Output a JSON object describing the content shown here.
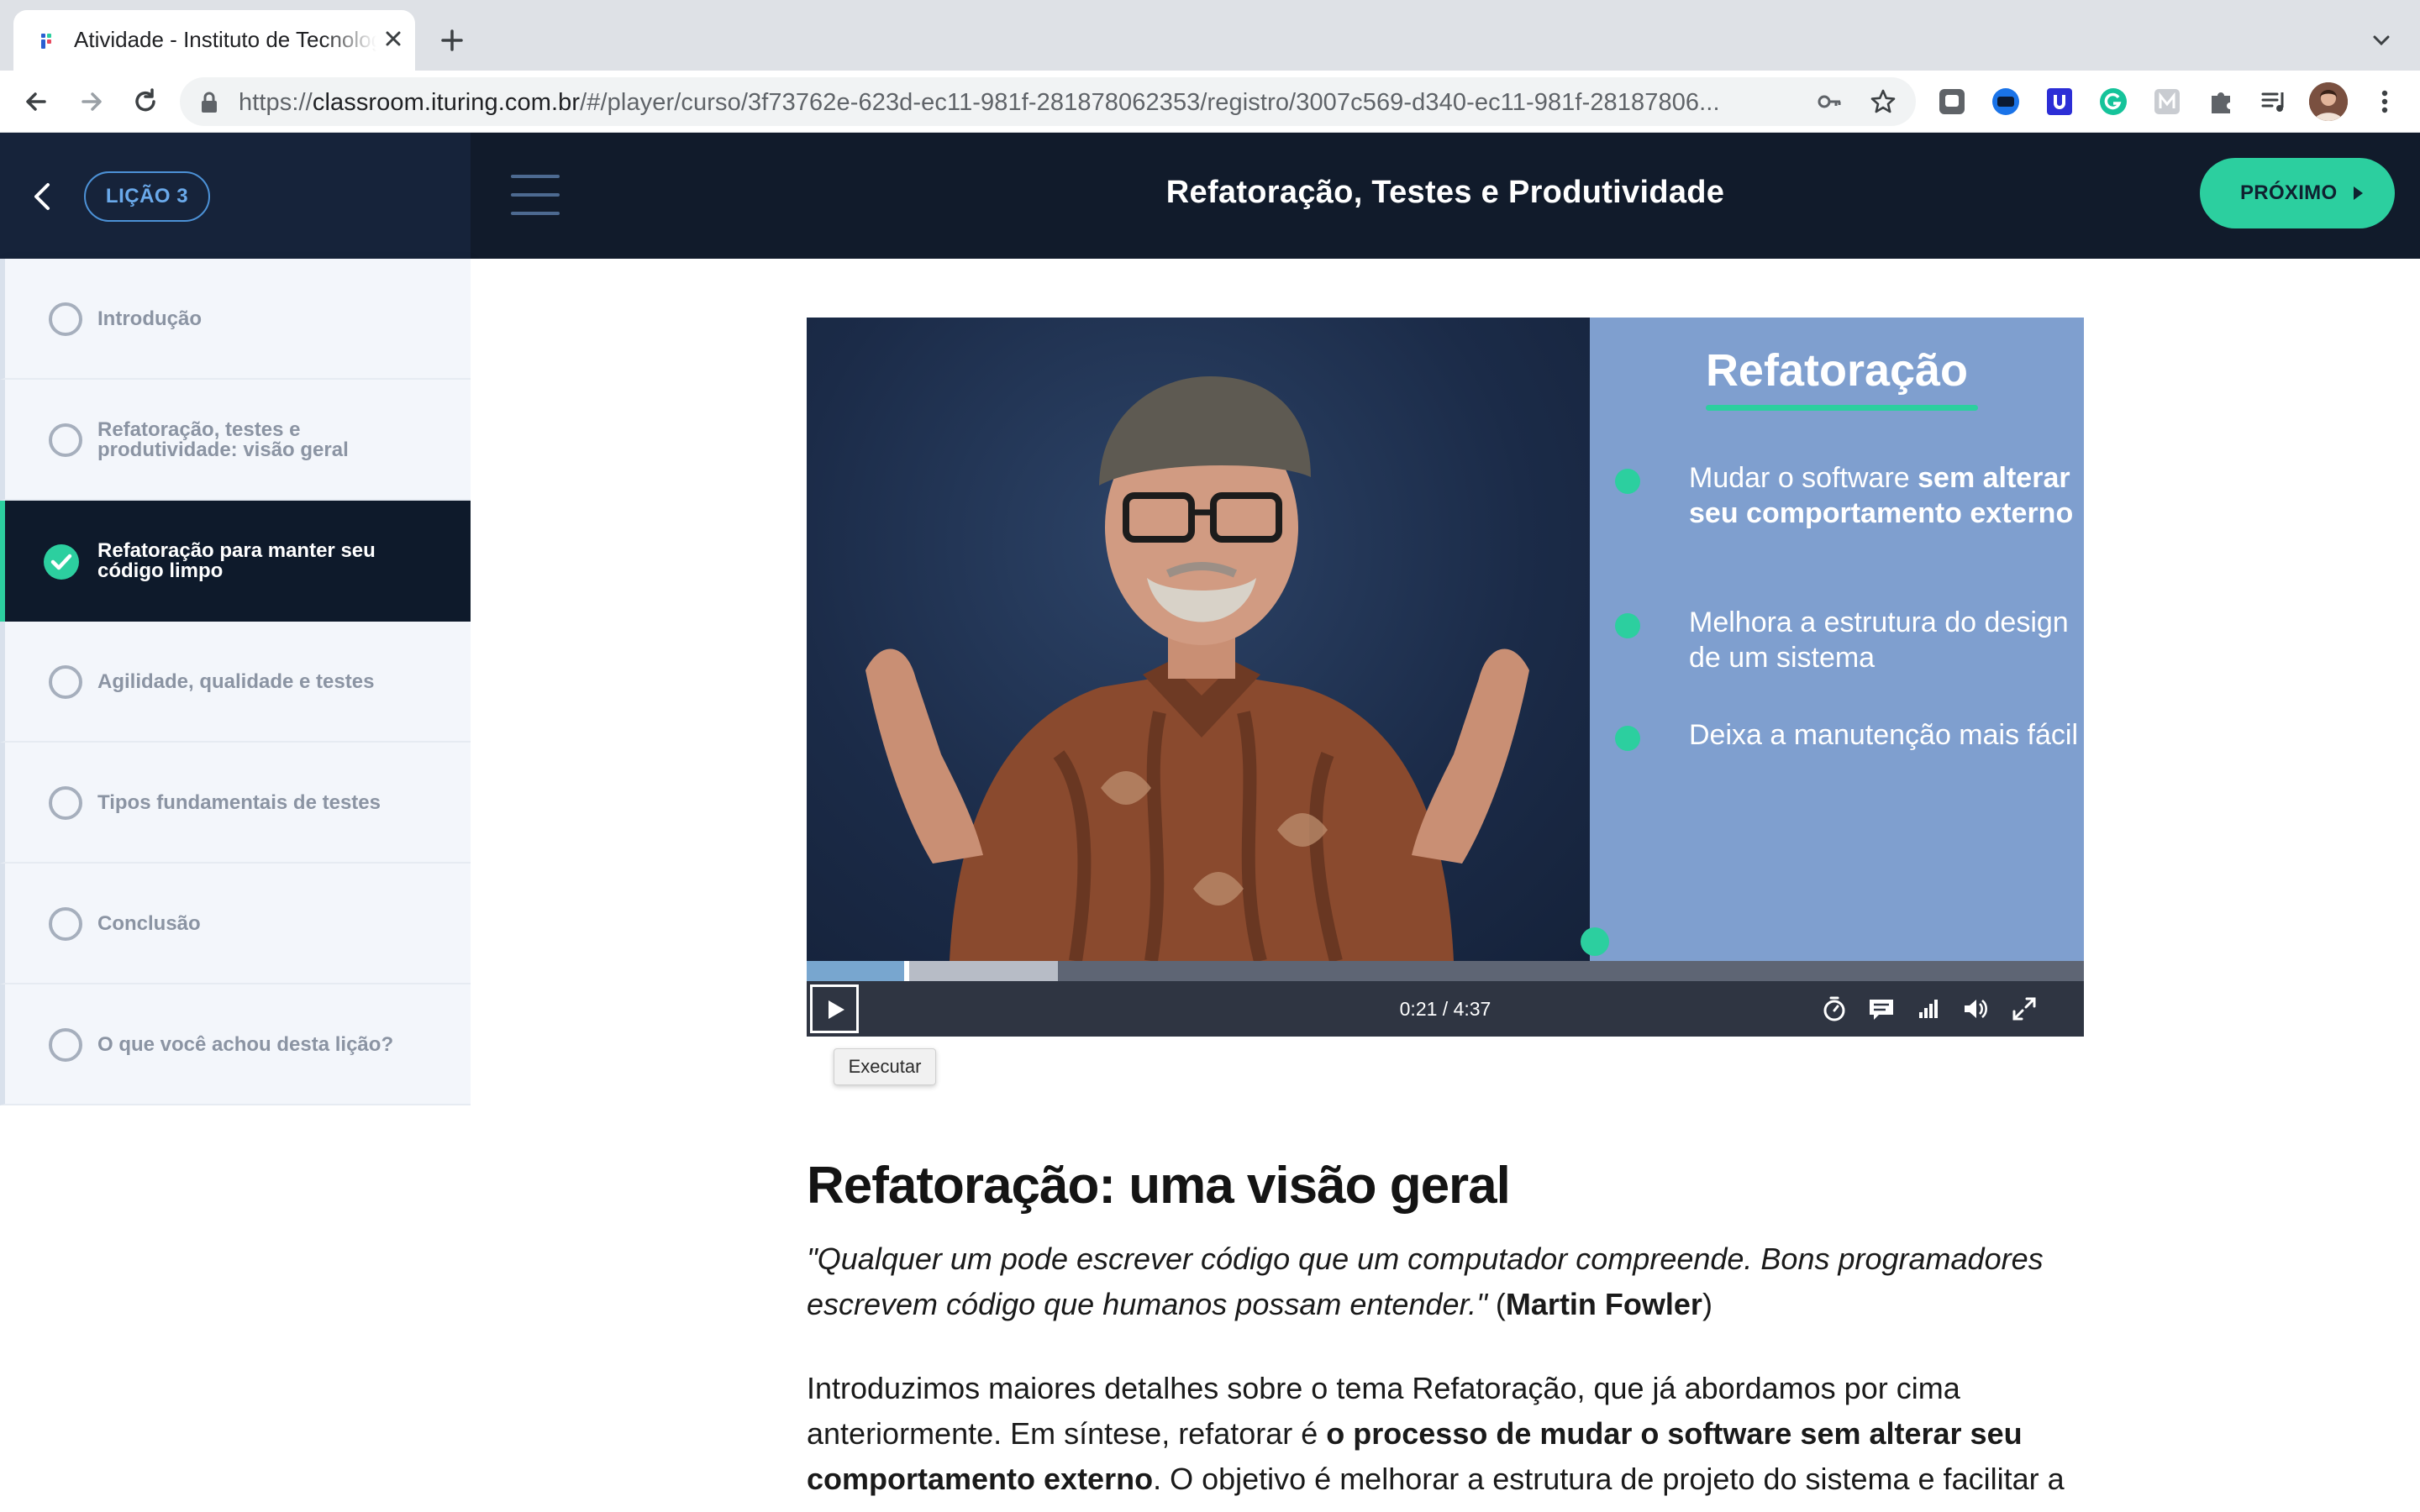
{
  "browser": {
    "tab_title": "Atividade - Instituto de Tecnologia",
    "url_prefix": "https://",
    "url_host": "classroom.ituring.com.br",
    "url_rest": "/#/player/curso/3f73762e-623d-ec11-981f-281878062353/registro/3007c569-d340-ec11-981f-28187806..."
  },
  "header": {
    "lesson_label": "LIÇÃO 3",
    "course_title": "Refatoração, Testes e Produtividade",
    "next_label": "PRÓXIMO"
  },
  "sidebar": {
    "items": [
      {
        "label": "Introdução",
        "completed": false,
        "active": false
      },
      {
        "label": "Refatoração, testes e produtividade: visão geral",
        "completed": false,
        "active": false
      },
      {
        "label": "Refatoração para manter seu código limpo",
        "completed": true,
        "active": true
      },
      {
        "label": "Agilidade, qualidade e testes",
        "completed": false,
        "active": false
      },
      {
        "label": "Tipos fundamentais de testes",
        "completed": false,
        "active": false
      },
      {
        "label": "Conclusão",
        "completed": false,
        "active": false
      },
      {
        "label": "O que você achou desta lição?",
        "completed": false,
        "active": false
      }
    ]
  },
  "video": {
    "slide_title": "Refatoração",
    "bullets": [
      {
        "text": "Mudar o software ",
        "bold": "sem alterar seu comportamento externo"
      },
      {
        "text": "Melhora a estrutura do design de um sistema",
        "bold": ""
      },
      {
        "text": "Deixa a manutenção mais fácil",
        "bold": ""
      }
    ],
    "time_display": "0:21 / 4:37",
    "progress_played_fraction": 0.076,
    "progress_buffered_fraction": 0.197,
    "play_tooltip": "Executar"
  },
  "article": {
    "title": "Refatoração: uma visão geral",
    "quote_text": "\"Qualquer um pode escrever código que um computador compreende. Bons programadores escrevem código que humanos possam entender.\"",
    "quote_open": " (",
    "quote_author": "Martin Fowler",
    "quote_close": ")",
    "para_1": "Introduzimos maiores detalhes sobre o tema Refatoração, que já abordamos por cima anteriormente. Em síntese, refatorar é ",
    "para_bold": "o processo de mudar o software sem alterar seu comportamento externo",
    "para_2": ". O objetivo é melhorar a estrutura de projeto do sistema e facilitar a"
  },
  "colors": {
    "accent": "#2ccf9f",
    "topbar": "#111b2b",
    "slide_bg": "#7f9fcf"
  }
}
